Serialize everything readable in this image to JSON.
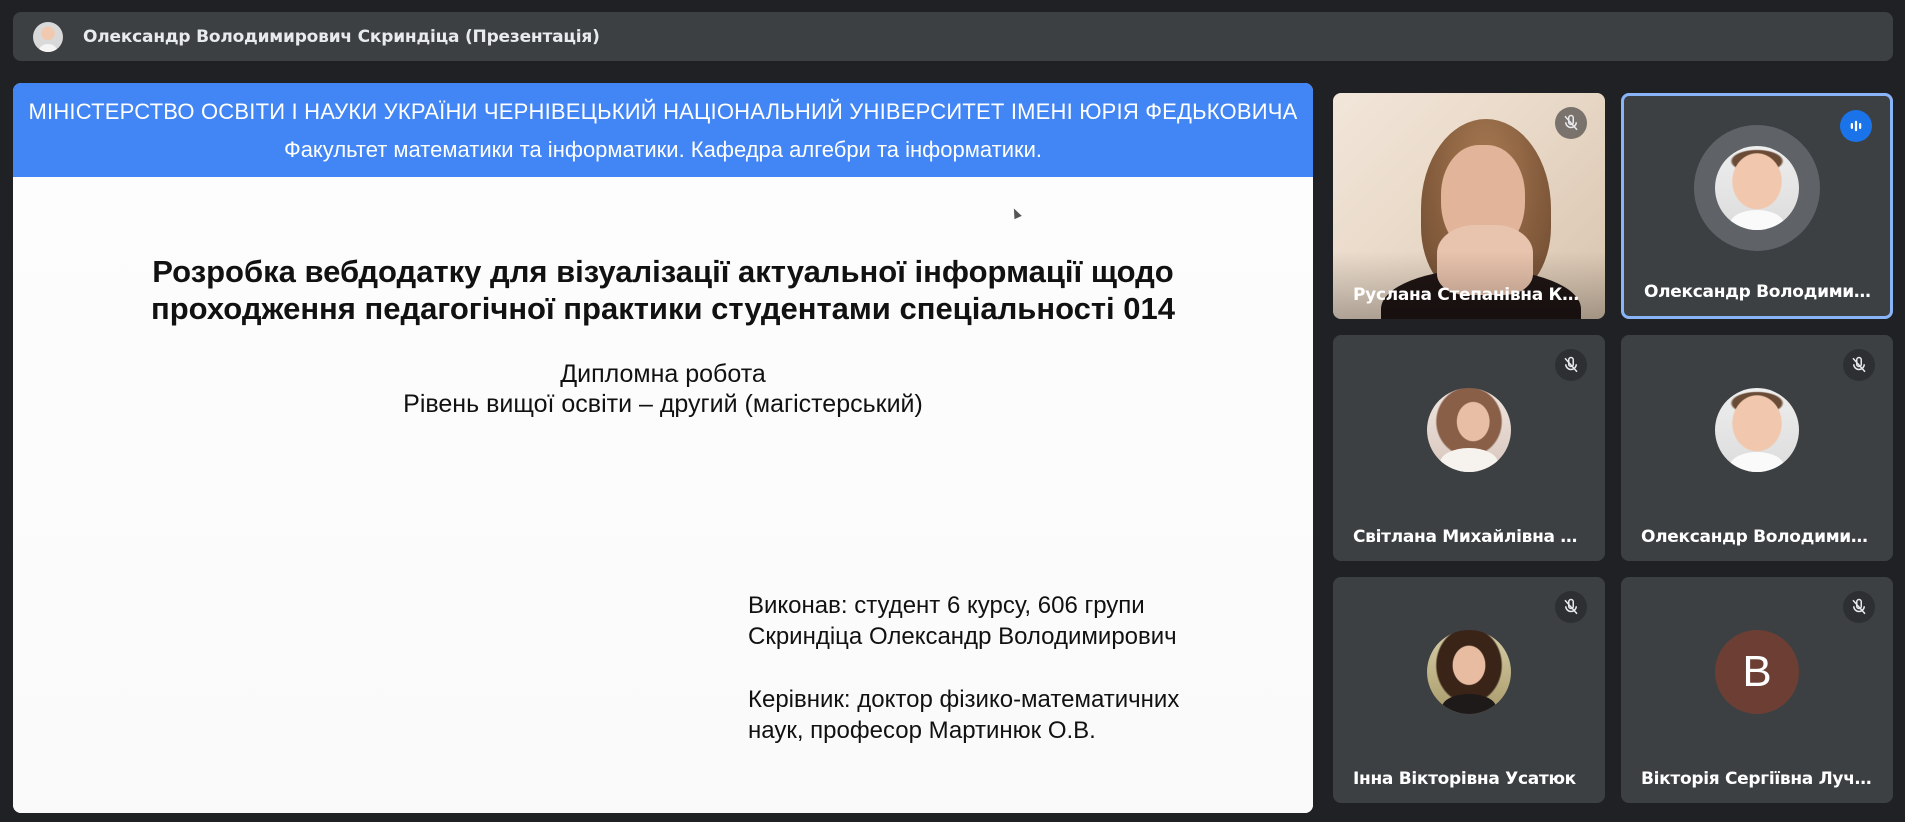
{
  "presenter_bar": {
    "title": "Олександр Володимирович Скриндіца (Презентація)"
  },
  "slide": {
    "header_line1": "МІНІСТЕРСТВО ОСВІТИ І НАУКИ УКРАЇНИ ЧЕРНІВЕЦЬКИЙ НАЦІОНАЛЬНИЙ УНІВЕРСИТЕТ ІМЕНІ ЮРІЯ ФЕДЬКОВИЧА",
    "header_line2": "Факультет математики та інформатики. Кафедра алгебри та інформатики.",
    "title_line1": "Розробка вебдодатку для візуалізації актуальної інформації щодо",
    "title_line2": "проходження педагогічної практики студентами спеціальності 014",
    "subtitle_line1": "Дипломна робота",
    "subtitle_line2": "Рівень вищої освіти – другий (магістерський)",
    "author_line1": "Виконав:  студент 6 курсу, 606 групи",
    "author_line2": "Скриндіца Олександр Володимирович",
    "supervisor_line1": "Керівник:  доктор фізико-математичних",
    "supervisor_line2": "наук,  професор Мартинюк О.В."
  },
  "participants": [
    {
      "name": "Руслана Степанівна Колі...",
      "mic": "muted",
      "avatar": "video"
    },
    {
      "name": "Олександр Володимиро...",
      "mic": "speaking",
      "avatar": "photo"
    },
    {
      "name": "Світлана Михайлівна Лев...",
      "mic": "muted",
      "avatar": "photo"
    },
    {
      "name": "Олександр Володимиро...",
      "mic": "muted",
      "avatar": "photo"
    },
    {
      "name": "Інна Вікторівна Усатюк",
      "mic": "muted",
      "avatar": "photo"
    },
    {
      "name": "Вікторія Сергіївна Лучко",
      "mic": "muted",
      "avatar": "letter",
      "letter": "В"
    }
  ],
  "colors": {
    "background": "#202124",
    "tile": "#3c4043",
    "slide_band": "#4285f4",
    "active_border": "#8ab4f8",
    "speaking_badge": "#1a73e8"
  }
}
